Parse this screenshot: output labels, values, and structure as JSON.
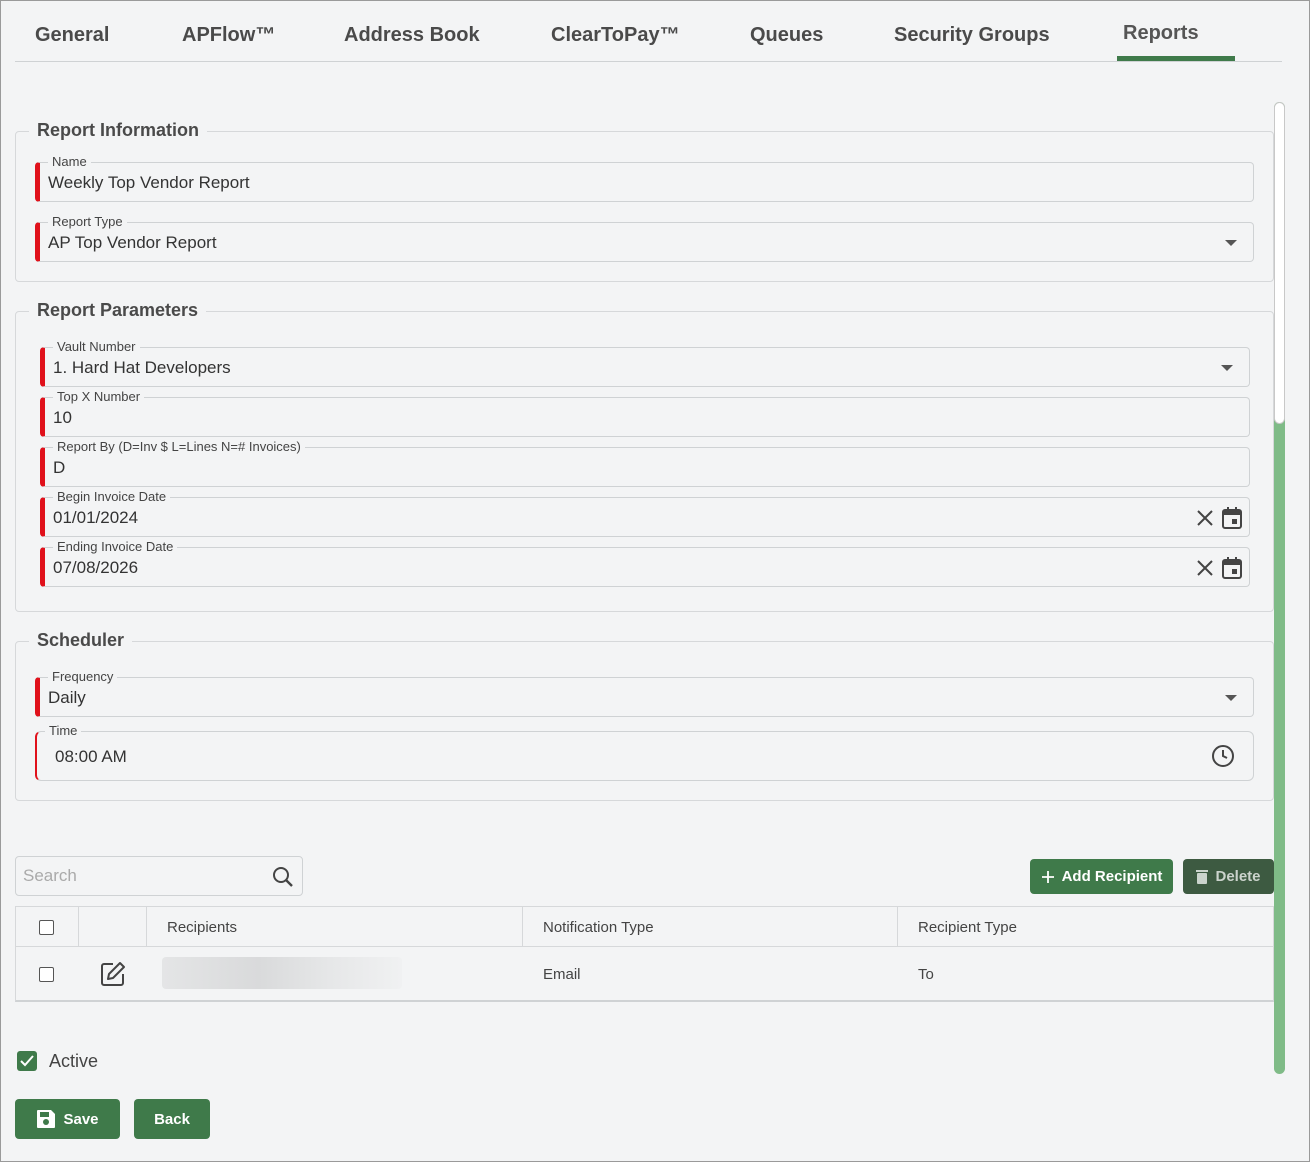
{
  "tabs": {
    "general": "General",
    "apflow": "APFlow™",
    "address_book": "Address Book",
    "cleartopay": "ClearToPay™",
    "queues": "Queues",
    "security_groups": "Security Groups",
    "reports": "Reports",
    "active_tab": "Reports"
  },
  "report_information": {
    "title": "Report Information",
    "name_label": "Name",
    "name_value": "Weekly Top Vendor Report",
    "type_label": "Report Type",
    "type_value": "AP Top Vendor Report"
  },
  "report_parameters": {
    "title": "Report Parameters",
    "vault_label": "Vault Number",
    "vault_value": "1. Hard Hat Developers",
    "topx_label": "Top X Number",
    "topx_value": "10",
    "reportby_label": "Report By (D=Inv $ L=Lines N=# Invoices)",
    "reportby_value": "D",
    "begin_label": "Begin Invoice Date",
    "begin_value": "01/01/2024",
    "end_label": "Ending Invoice Date",
    "end_value": "07/08/2026"
  },
  "scheduler": {
    "title": "Scheduler",
    "frequency_label": "Frequency",
    "frequency_value": "Daily",
    "time_label": "Time",
    "time_value": "08:00 AM"
  },
  "recipients": {
    "search_placeholder": "Search",
    "add_label": "Add Recipient",
    "delete_label": "Delete",
    "columns": [
      "Recipients",
      "Notification Type",
      "Recipient Type"
    ],
    "rows": [
      {
        "recipient": "",
        "notification_type": "Email",
        "recipient_type": "To"
      }
    ]
  },
  "active": {
    "label": "Active",
    "checked": true
  },
  "actions": {
    "save_label": "Save",
    "back_label": "Back"
  },
  "colors": {
    "accent": "#3f7a4a",
    "required": "#e0111b",
    "scrollbar": "#7fbb87"
  }
}
